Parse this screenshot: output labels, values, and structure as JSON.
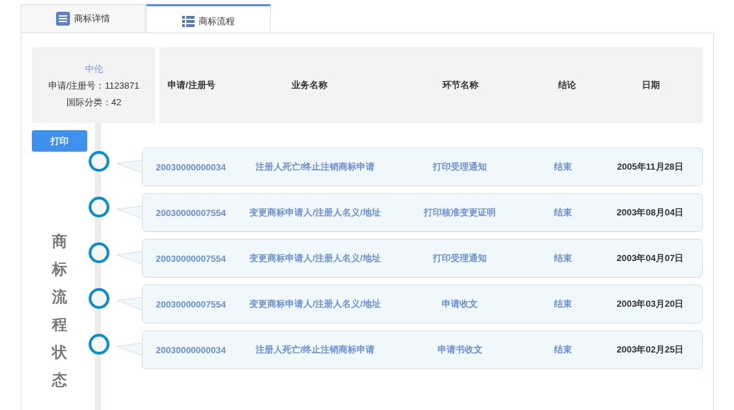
{
  "tabs": [
    {
      "label": "商标详情",
      "kind": "document",
      "selected": false
    },
    {
      "label": "商标流程",
      "kind": "list",
      "selected": true
    }
  ],
  "summary": {
    "name": "中伦",
    "reg_number": "申请/注册号：1123871",
    "class": "国际分类：42"
  },
  "table": {
    "columns": [
      "申请/注册号",
      "业务名称",
      "环节名称",
      "结论",
      "日期"
    ],
    "rows": [
      {
        "reg_no": "20030000000034",
        "business": "注册人死亡/终止注销商标申请",
        "step": "打印受理通知",
        "result": "结束",
        "date": "2005年11月28日"
      },
      {
        "reg_no": "20030000007554",
        "business": "变更商标申请人/注册人名义/地址",
        "step": "打印核准变更证明",
        "result": "结束",
        "date": "2003年08月04日"
      },
      {
        "reg_no": "20030000007554",
        "business": "变更商标申请人/注册人名义/地址",
        "step": "打印受理通知",
        "result": "结束",
        "date": "2003年04月07日"
      },
      {
        "reg_no": "20030000007554",
        "business": "变更商标申请人/注册人名义/地址",
        "step": "申请收文",
        "result": "结束",
        "date": "2003年03月20日"
      },
      {
        "reg_no": "20030000000034",
        "business": "注册人死亡/终止注销商标申请",
        "step": "申请书收文",
        "result": "结束",
        "date": "2003年02月25日"
      }
    ]
  },
  "print_button": "打印",
  "timeline_label": "商标流程状态"
}
